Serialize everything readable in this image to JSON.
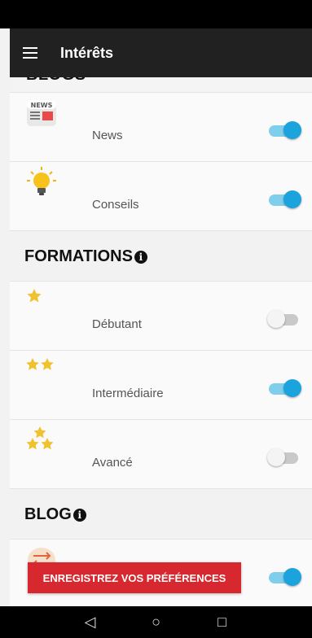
{
  "app": {
    "title": "Intérêts",
    "top_section_peek": "BLOGS"
  },
  "rows_blogs": [
    {
      "label": "News",
      "icon": "news-icon",
      "enabled": true
    },
    {
      "label": "Conseils",
      "icon": "lightbulb-icon",
      "enabled": true
    }
  ],
  "section_formations": {
    "title": "FORMATIONS",
    "info_glyph": "i"
  },
  "rows_formations": [
    {
      "label": "Débutant",
      "icon": "one-star-icon",
      "enabled": false
    },
    {
      "label": "Intermédiaire",
      "icon": "two-stars-icon",
      "enabled": true
    },
    {
      "label": "Avancé",
      "icon": "three-stars-icon",
      "enabled": false
    }
  ],
  "section_blog": {
    "title": "BLOG",
    "info_glyph": "i"
  },
  "rows_blog": [
    {
      "label": "",
      "icon": "exchange-icon",
      "enabled": true
    }
  ],
  "save_button": {
    "label": "ENREGISTREZ VOS PRÉFÉRENCES"
  },
  "nav": {
    "back": "◁",
    "home": "○",
    "recents": "□"
  },
  "colors": {
    "toggle_on": "#1aa3dc",
    "toggle_on_track": "#7fcfec",
    "button": "#d7282f",
    "appbar": "#212121"
  }
}
